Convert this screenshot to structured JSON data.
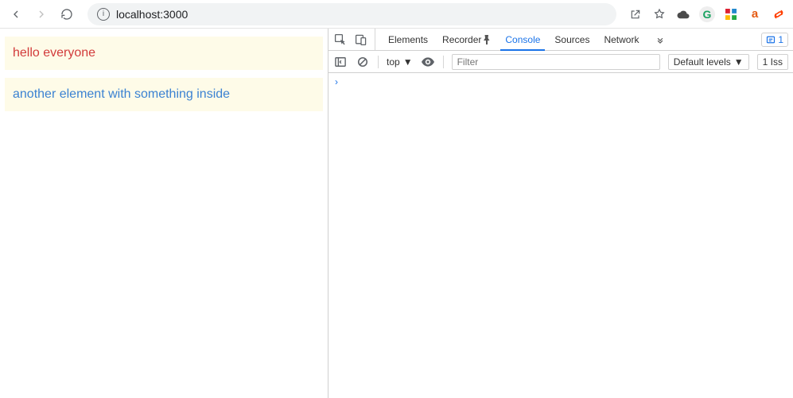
{
  "browser": {
    "url": "localhost:3000",
    "extensions": [
      "share",
      "star",
      "cloud",
      "grammarly",
      "colorzilla",
      "a-ext",
      "svelte"
    ]
  },
  "page": {
    "elements": [
      {
        "text": "hello everyone",
        "style": "red"
      },
      {
        "text": "another element with something inside",
        "style": "blue"
      }
    ]
  },
  "devtools": {
    "tabs": [
      "Elements",
      "Recorder",
      "Console",
      "Sources",
      "Network"
    ],
    "active_tab": "Console",
    "issues_badge": "1",
    "console_bar": {
      "scope": "top",
      "filter_placeholder": "Filter",
      "levels_label": "Default levels",
      "issues_label": "1 Iss"
    }
  }
}
